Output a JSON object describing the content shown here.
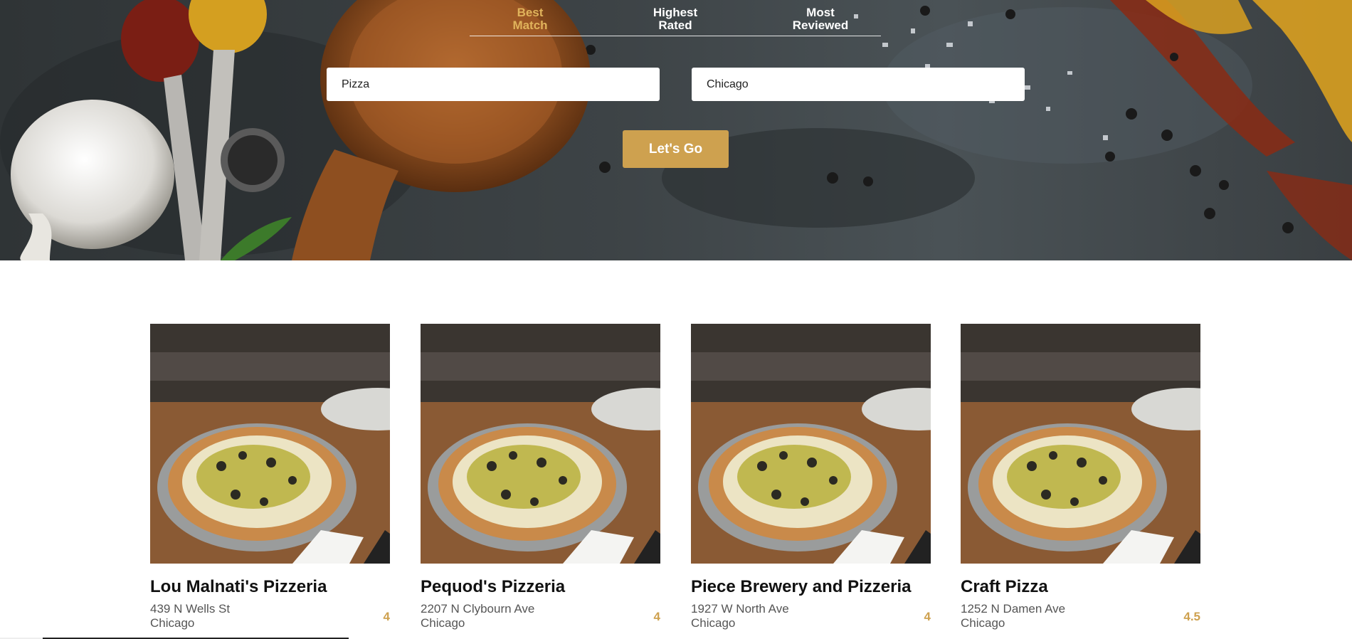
{
  "colors": {
    "accent": "#cea14f",
    "active_tab": "#e0b35b",
    "hero_bg": "#3d4346"
  },
  "tabs": [
    {
      "label": "Best\nMatch",
      "active": true
    },
    {
      "label": "Highest\nRated",
      "active": false
    },
    {
      "label": "Most\nReviewed",
      "active": false
    }
  ],
  "search": {
    "term_value": "Pizza",
    "location_value": "Chicago",
    "submit_label": "Let's Go"
  },
  "businesses": [
    {
      "name": "Lou Malnati's Pizzeria",
      "address": "439 N Wells St",
      "city": "Chicago",
      "rating": "4"
    },
    {
      "name": "Pequod's Pizzeria",
      "address": "2207 N Clybourn Ave",
      "city": "Chicago",
      "rating": "4"
    },
    {
      "name": "Piece Brewery and Pizzeria",
      "address": "1927 W North Ave",
      "city": "Chicago",
      "rating": "4"
    },
    {
      "name": "Craft Pizza",
      "address": "1252 N Damen Ave",
      "city": "Chicago",
      "rating": "4.5"
    }
  ]
}
